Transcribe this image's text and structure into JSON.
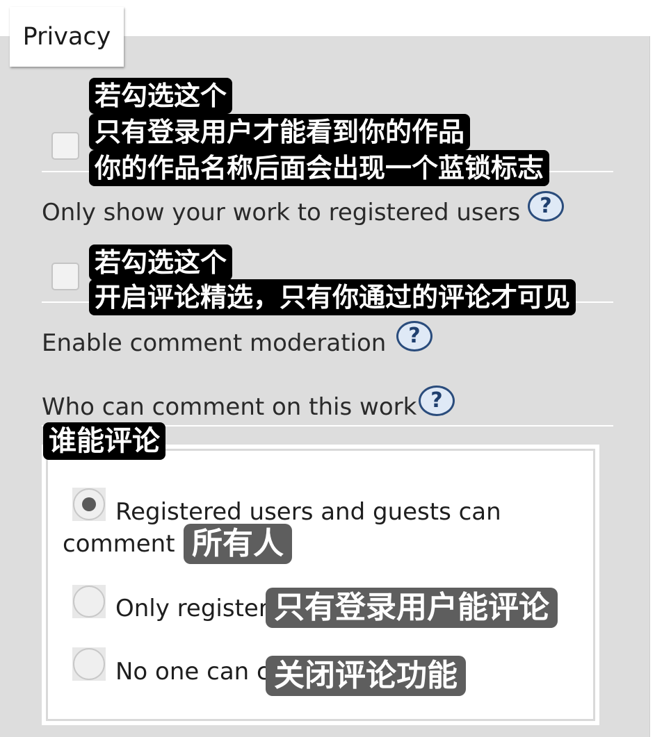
{
  "tab": {
    "label": "Privacy"
  },
  "option_registered_only": {
    "label": "Only show your work to registered users",
    "help": "?",
    "caption_lines": [
      "若勾选这个",
      "只有登录用户才能看到你的作品",
      "你的作品名称后面会出现一个蓝锁标志"
    ]
  },
  "option_moderation": {
    "label": "Enable comment moderation",
    "help": "?",
    "caption_lines": [
      "若勾选这个",
      "开启评论精选，只有你通过的评论才可见"
    ]
  },
  "who_can_comment": {
    "label": "Who can comment on this work",
    "help": "?",
    "caption": "谁能评论",
    "options": [
      {
        "label": "Registered users and guests can comment",
        "caption": "所有人",
        "selected": true
      },
      {
        "label": "Only registered users can comment",
        "caption": "只有登录用户能评论",
        "selected": false
      },
      {
        "label": "No one can comment",
        "caption": "关闭评论功能",
        "selected": false
      }
    ]
  }
}
